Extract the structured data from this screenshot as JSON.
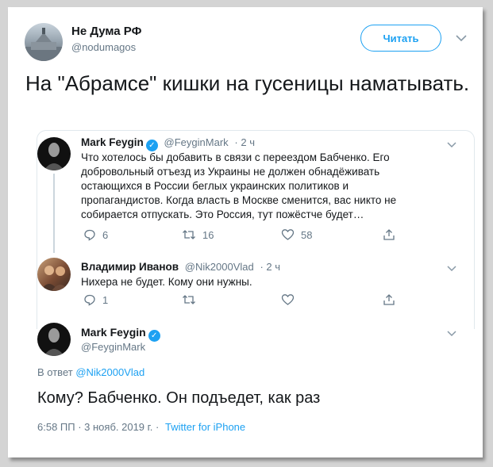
{
  "account": {
    "name": "Не Дума РФ",
    "handle": "@nodumagos",
    "follow_label": "Читать"
  },
  "tweet": {
    "text": "На \"Абрамсе\" кишки на гусеницы наматывать."
  },
  "quoted": {
    "author": "Mark Feygin",
    "handle": "@FeyginMark",
    "time": "· 2 ч",
    "text": "Что хотелось бы добавить в связи с переездом Бабченко. Его добровольный отъезд из Украины не должен обнадёживать остающихся в России беглых украинских политиков и пропагандистов. Когда власть в Москве сменится, вас никто не собирается отпускать. Это Россия, тут пожёстче будет…",
    "replies": "6",
    "retweets": "16",
    "likes": "58"
  },
  "reply1": {
    "author": "Владимир Иванов",
    "handle": "@Nik2000Vlad",
    "time": "· 2 ч",
    "text": "Нихера не будет. Кому они нужны.",
    "replies": "1"
  },
  "reply2": {
    "author": "Mark Feygin",
    "handle": "@FeyginMark",
    "in_reply_prefix": "В ответ",
    "in_reply_handle": "@Nik2000Vlad",
    "text": "Кому? Бабченко. Он подъедет, как раз",
    "timestamp": "6:58 ПП · 3 нояб. 2019 г. ·",
    "source": "Twitter for iPhone"
  },
  "colors": {
    "accent": "#1da1f2",
    "muted": "#657786",
    "text": "#14171a"
  }
}
